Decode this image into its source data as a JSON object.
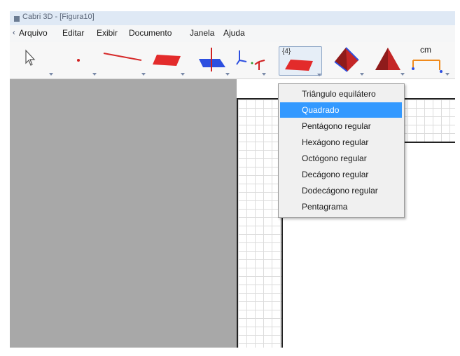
{
  "window": {
    "title": "Cabri 3D - [Figura10]"
  },
  "menu": {
    "items": [
      "Arquivo",
      "Editar",
      "Exibir",
      "Documento",
      "Janela",
      "Ajuda"
    ]
  },
  "toolbar": {
    "polygon_tool_label": "{4}",
    "measure_tool_label": "cm"
  },
  "dropdown": {
    "selected_index": 1,
    "items": [
      "Triângulo equilátero",
      "Quadrado",
      "Pentágono regular",
      "Hexágono regular",
      "Octógono regular",
      "Decágono regular",
      "Dodecágono regular",
      "Pentagrama"
    ]
  },
  "colors": {
    "selection": "#3399ff",
    "shape_red": "#e32b2b",
    "shape_blue": "#2d4fe0",
    "canvas_gray": "#a8a8a8"
  }
}
